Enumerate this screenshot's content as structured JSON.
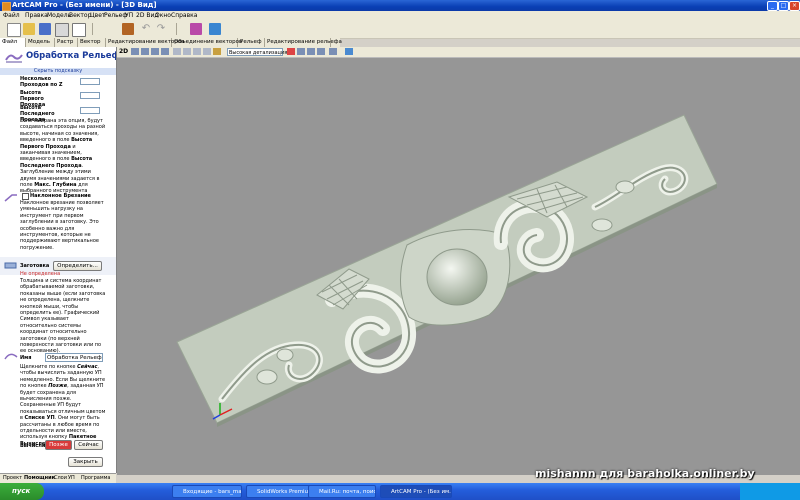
{
  "window": {
    "title": "ArtCAM Pro - (Без имени) - [3D Вид]"
  },
  "menu": [
    "Файл",
    "Правка",
    "Модель",
    "Вектор",
    "Цвет",
    "Рельеф",
    "УП",
    "2D Вид",
    "Окно",
    "Справка"
  ],
  "tabs": [
    "Файл",
    "Модель",
    "Растр",
    "Вектор",
    "Редактирование векторов",
    "Объединение векторов",
    "Рельеф",
    "Редактирование рельефа"
  ],
  "view_toolbar": {
    "zoom_label": "2D",
    "detail": "Высокая детализация"
  },
  "panel": {
    "title": "Обработка Рельефа",
    "hide_help": "Скрыть подсказку",
    "multi_passes_label": "Несколько Проходов по Z",
    "first_pass_label": "Высота Первого Прохода",
    "last_pass_label": "Высота Последнего Прохода",
    "help1_a": "Если выбрана эта опция, будут создаваться проходы на разной высоте, начиная со значения, введенного в поле ",
    "help1_b": "Высота Первого Прохода",
    "help1_c": " и заканчивая значением, введенного в поле ",
    "help1_d": "Высота Последнего Прохода",
    "help1_e": ". Заглубление между этими двумя значениями задается в поле ",
    "help1_f": "Макс. Глубина",
    "help1_g": " для выбранного инструмента",
    "ramp_label": "Наклонное Врезание",
    "ramp_help": "Наклонное врезание позволяет уменьшить нагрузку на инструмент при первом заглублении в заготовку. Это особенно важно для инструментов, которые не поддерживают вертикальное погружение.",
    "material_label": "Заготовка",
    "define_button": "Определить...",
    "not_defined": "Не определена",
    "material_help": "Толщина и система координат обрабатываемой заготовки, показаны выше (если заготовка не определена, щелкните кнопкой мыши, чтобы определить ее). Графический Символ указывает относительно системы координат относительно заготовки (по верхней поверхности заготовки или по ее основанию).",
    "name_label": "Имя",
    "name_value": "Обработка Рельефа",
    "name_help_a": "Щелкните по кнопке ",
    "name_help_b": "Сейчас",
    "name_help_c": ", чтобы вычислить заданную УП немедленно. Если Вы щелкните по кнопке ",
    "name_help_d": "Позже",
    "name_help_e": ", заданная УП будет сохранена для вычисления позже. Сохраненные УП будут показываться отличным цветом в ",
    "name_help_f": "Списке УП",
    "name_help_g": ". Они могут быть рассчитаны в любое время по отдельности или вместе, используя кнопку ",
    "name_help_h": "Пакетное Вычисление УП",
    "calc_label": "Вычислить",
    "later_button": "Позже",
    "now_button": "Сейчас",
    "close_button": "Закрыть",
    "bottom_tabs": [
      "Проект",
      "Помощник",
      "Слои",
      "УП",
      "Программа"
    ]
  },
  "taskbar": {
    "start": "пуск",
    "tasks": [
      "Входящие - bars_ma...",
      "SolidWorks Premium 2...",
      "Mail.Ru: почта, поис...",
      "ArtCAM Pro - (Без им..."
    ]
  },
  "watermark": "mishannn для baraholka.onliner.by",
  "colors": {
    "title_blue": "#0a3fb5",
    "viewport_bg": "#969696",
    "relief": "#c9d1c4",
    "not_defined_red": "#cc2a2a",
    "later_button_red": "#d83a3a"
  }
}
